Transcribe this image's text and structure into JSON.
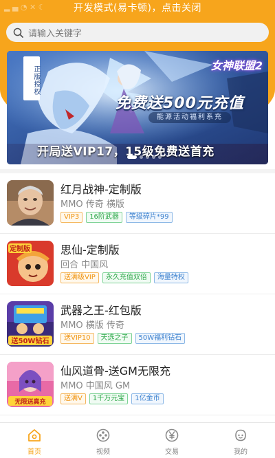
{
  "statusbar": {
    "dev_mode_text": "开发模式(易卡顿)，点击关闭"
  },
  "search": {
    "placeholder": "请输入关键字",
    "icon": "search-icon"
  },
  "banner": {
    "vertical_tag": "正版授权",
    "logo_text": "女神联盟2",
    "headline": "免费送500元充值",
    "subline": "能源活动福利系充",
    "footer_text": "开局送VIP17，15级免费送首充",
    "page_count": 5,
    "active_page": 1
  },
  "games": [
    {
      "title": "红月战神-定制版",
      "meta": "MMO 传奇 横版",
      "tags": [
        {
          "text": "VIP3",
          "color": "orange"
        },
        {
          "text": "16阶武器",
          "color": "green"
        },
        {
          "text": "等级碎片*99",
          "color": "blue"
        }
      ]
    },
    {
      "title": "思仙-定制版",
      "meta": "回合 中国风",
      "icon_text": "定制版",
      "tags": [
        {
          "text": "送满级VIP",
          "color": "orange"
        },
        {
          "text": "永久充值双倍",
          "color": "green"
        },
        {
          "text": "海量特权",
          "color": "blue"
        }
      ]
    },
    {
      "title": "武器之王-红包版",
      "meta": "MMO 横版 传奇",
      "icon_text": "送50W钻石",
      "tags": [
        {
          "text": "送VIP10",
          "color": "orange"
        },
        {
          "text": "天选之子",
          "color": "green"
        },
        {
          "text": "50W福利钻石",
          "color": "blue"
        }
      ]
    },
    {
      "title": "仙风道骨-送GM无限充",
      "meta": "MMO 中国风 GM",
      "icon_text": "无限送真充",
      "tags": [
        {
          "text": "送满V",
          "color": "orange"
        },
        {
          "text": "1千万元宝",
          "color": "green"
        },
        {
          "text": "1亿金币",
          "color": "blue"
        }
      ]
    }
  ],
  "tabbar": {
    "items": [
      {
        "label": "首页",
        "icon": "home-icon",
        "active": true
      },
      {
        "label": "视频",
        "icon": "video-icon",
        "active": false
      },
      {
        "label": "交易",
        "icon": "yuan-icon",
        "active": false
      },
      {
        "label": "我的",
        "icon": "profile-icon",
        "active": false
      }
    ]
  },
  "colors": {
    "accent": "#f7a51c",
    "tag_orange": "#f0930f",
    "tag_green": "#2ea84a",
    "tag_blue": "#3d82cf"
  }
}
